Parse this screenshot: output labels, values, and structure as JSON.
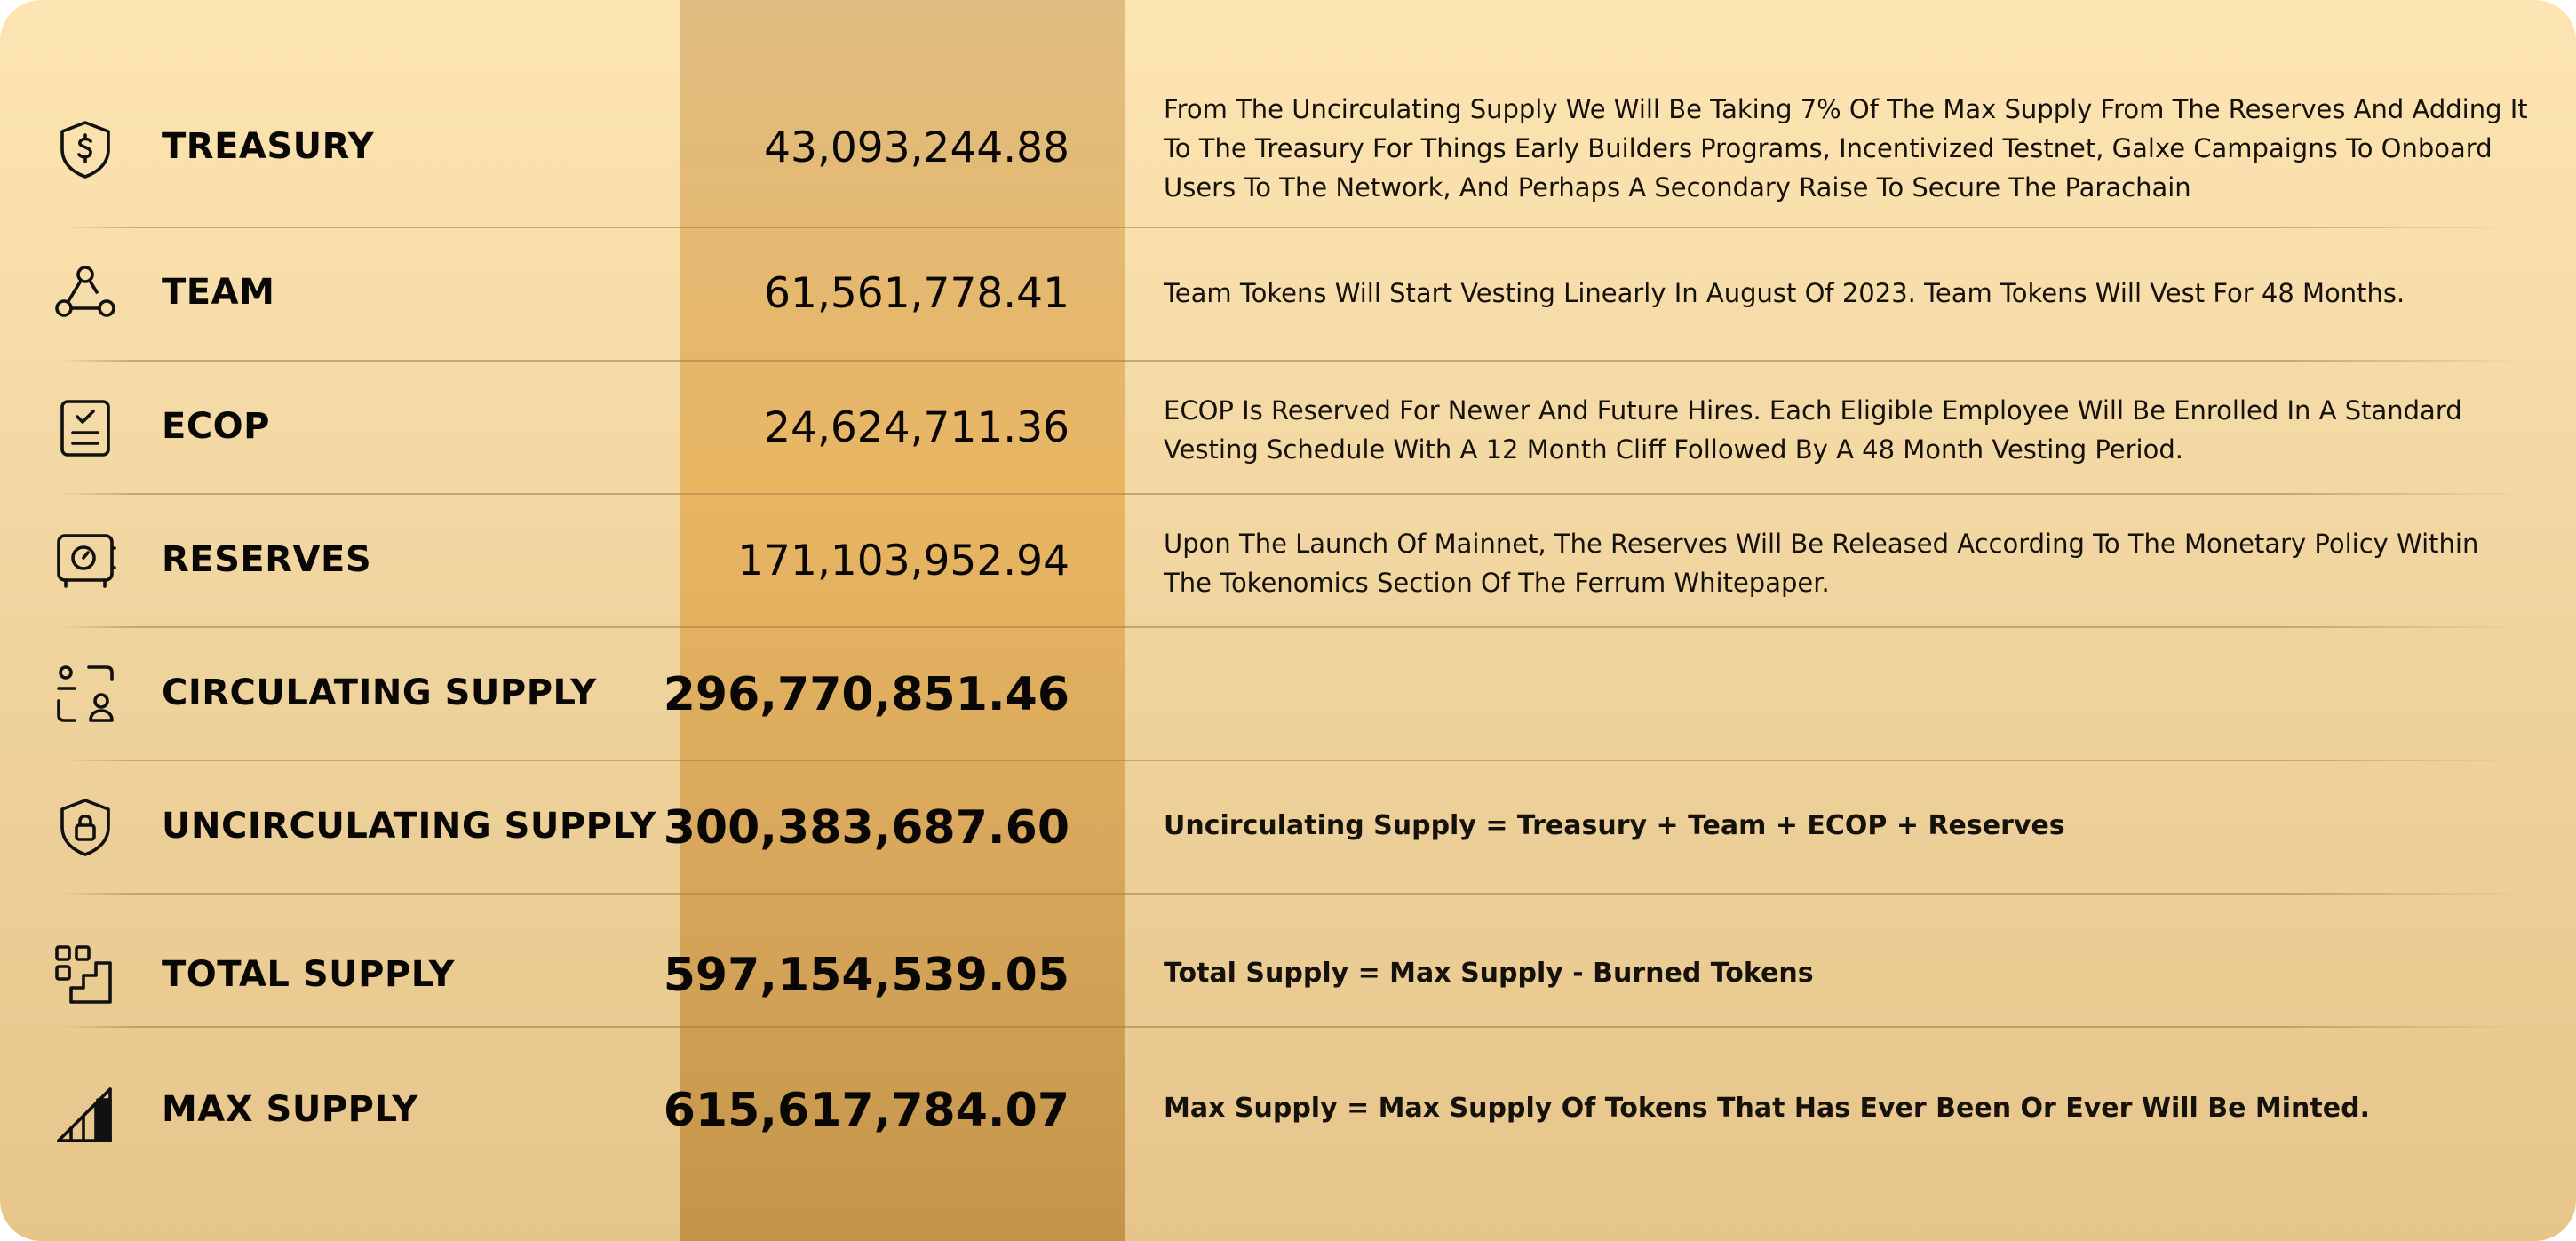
{
  "rows": [
    {
      "icon": "dollar-shield-icon",
      "label": "TREASURY",
      "value": "43,093,244.88",
      "description": "From The Uncirculating Supply We Will Be Taking 7% Of The Max Supply From The Reserves And Adding It To The Treasury For Things Early Builders Programs, Incentivized Testnet, Galxe Campaigns To Onboard Users To The Network, And Perhaps A Secondary Raise To Secure The Parachain"
    },
    {
      "icon": "team-network-icon",
      "label": "TEAM",
      "value": "61,561,778.41",
      "description": "Team Tokens Will Start Vesting Linearly In August Of 2023. Team Tokens Will Vest For 48 Months."
    },
    {
      "icon": "clipboard-check-icon",
      "label": "ECOP",
      "value": "24,624,711.36",
      "description": "ECOP Is Reserved For Newer And Future Hires. Each Eligible Employee Will Be Enrolled In A Standard Vesting Schedule With A 12 Month Cliff Followed By A 48 Month Vesting Period."
    },
    {
      "icon": "vault-safe-icon",
      "label": "RESERVES",
      "value": "171,103,952.94",
      "description": "Upon The Launch Of Mainnet, The Reserves Will Be Released According To The Monetary Policy Within The Tokenomics Section Of The Ferrum Whitepaper."
    },
    {
      "icon": "users-circulating-icon",
      "label": "CIRCULATING SUPPLY",
      "value": "296,770,851.46",
      "description": ""
    },
    {
      "icon": "lock-shield-icon",
      "label": "UNCIRCULATING SUPPLY",
      "value": "300,383,687.60",
      "description": "Uncirculating Supply = Treasury + Team + ECOP + Reserves"
    },
    {
      "icon": "blocks-stairs-icon",
      "label": "TOTAL SUPPLY",
      "value": "597,154,539.05",
      "description": "Total Supply = Max Supply - Burned Tokens"
    },
    {
      "icon": "signal-bars-icon",
      "label": "MAX SUPPLY",
      "value": "615,617,784.07",
      "description": "Max Supply = Max Supply Of Tokens That Has Ever Been Or Ever Will Be Minted."
    }
  ],
  "colors": {
    "card_top": "#fde5b3",
    "card_bottom": "#e6c58a",
    "column_accent": "#e8b562",
    "text": "#0a0806"
  }
}
